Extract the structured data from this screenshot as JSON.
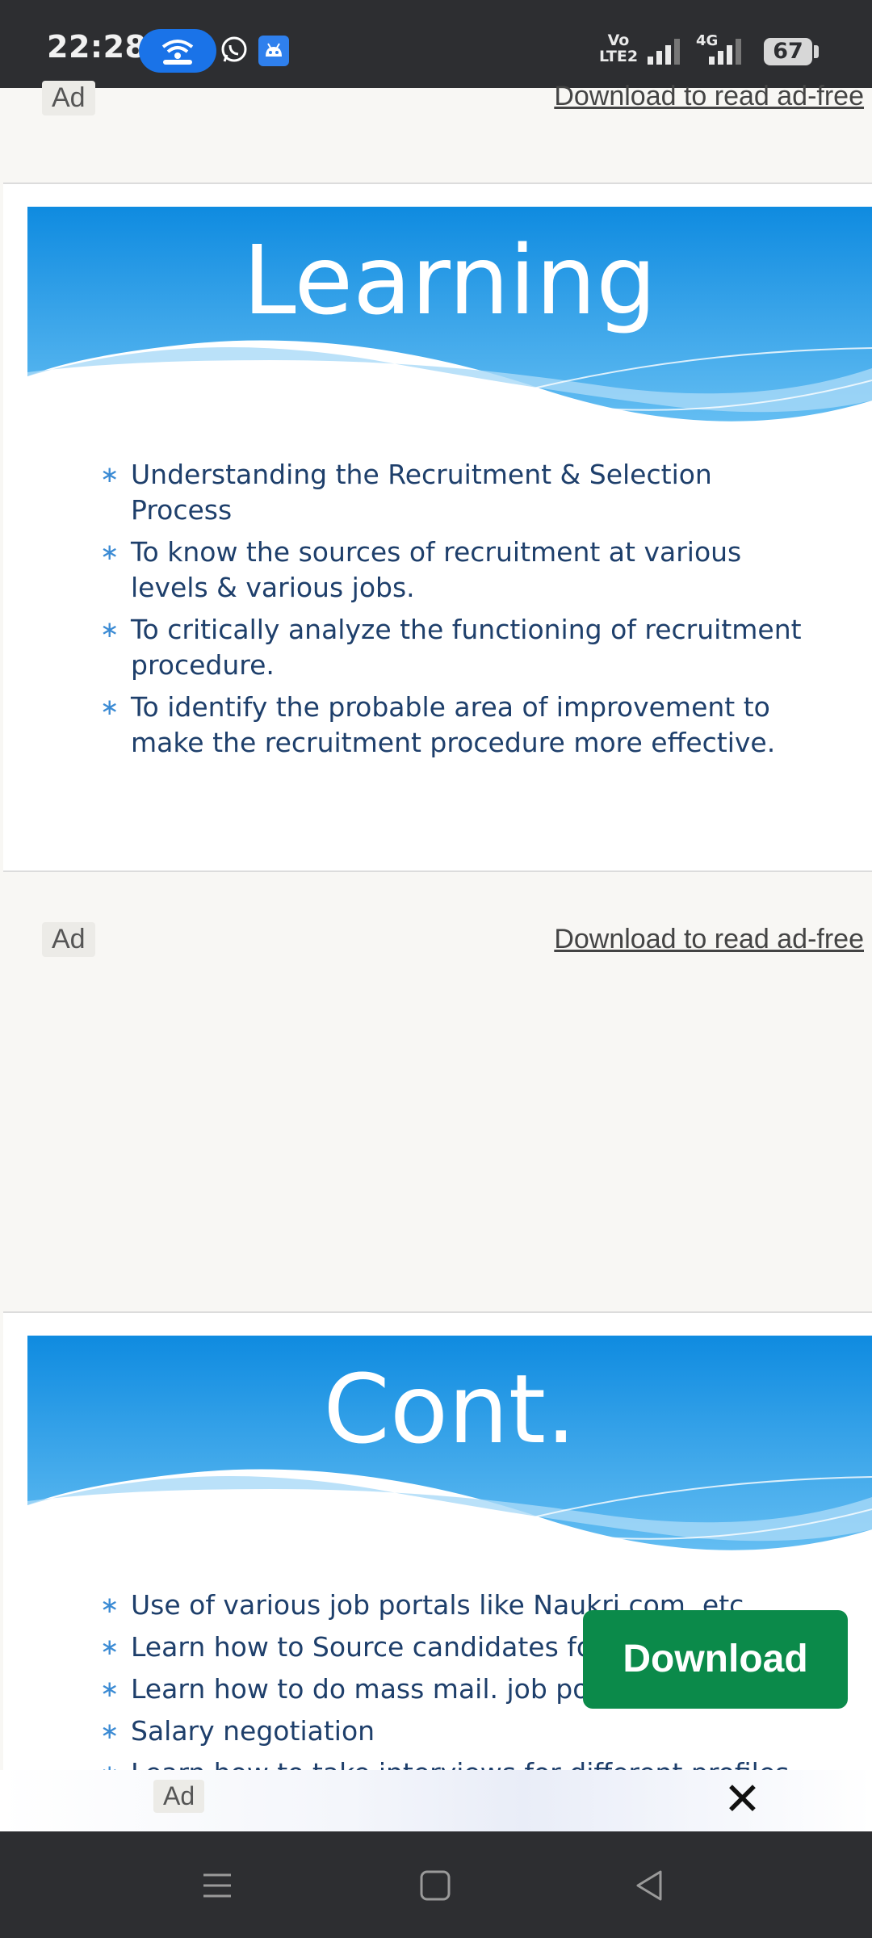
{
  "status_bar": {
    "time": "22:28",
    "volte_line1": "Vo",
    "volte_line2": "LTE2",
    "network": "4G",
    "battery": "67",
    "icons": [
      "hotspot-icon",
      "whatsapp-icon",
      "android-icon",
      "signal-icon",
      "signal-4g-icon",
      "battery-icon"
    ]
  },
  "ads": {
    "label": "Ad",
    "download_link": "Download to read ad-free"
  },
  "slides": [
    {
      "title": "Learning",
      "bullets": [
        "Understanding the Recruitment & Selection Process",
        "To know the sources of recruitment at various levels & various jobs.",
        "To critically analyze the functioning of recruitment procedure.",
        "To identify the probable area of improvement to make the recruitment procedure more effective."
      ]
    },
    {
      "title": "Cont.",
      "bullets": [
        "Use of various job portals like Naukri.com, etc",
        "Learn how to Source candidates for",
        "Learn how to do mass mail. job post",
        "Salary negotiation",
        "Learn how to take interviews for different profiles"
      ]
    }
  ],
  "download_button": "Download",
  "bottom_ad": {
    "label": "Ad",
    "close": "✕"
  },
  "colors": {
    "banner_blue": "#1a8fe0",
    "bullet_text": "#1e3f6b",
    "download_green": "#0b8a4a"
  }
}
